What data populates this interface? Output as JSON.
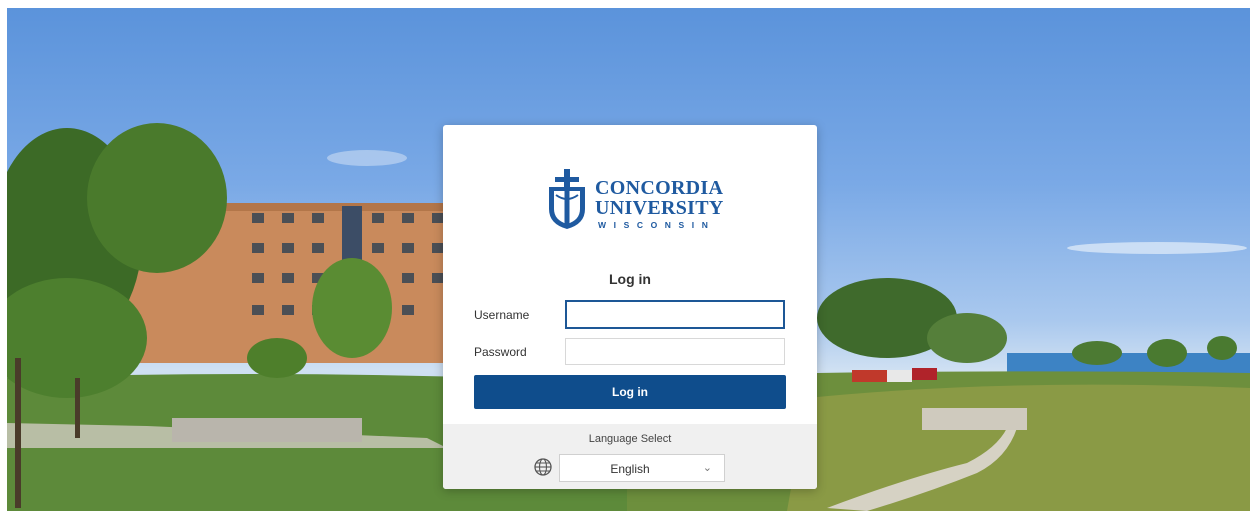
{
  "branding": {
    "line1": "CONCORDIA",
    "line2": "UNIVERSITY",
    "line3": "WISCONSIN"
  },
  "form": {
    "title": "Log in",
    "username_label": "Username",
    "username_value": "",
    "password_label": "Password",
    "password_value": "",
    "submit_label": "Log in"
  },
  "language": {
    "label": "Language Select",
    "selected": "English"
  },
  "colors": {
    "brand_blue": "#1f5aa0",
    "button_blue": "#0f4d8c"
  }
}
